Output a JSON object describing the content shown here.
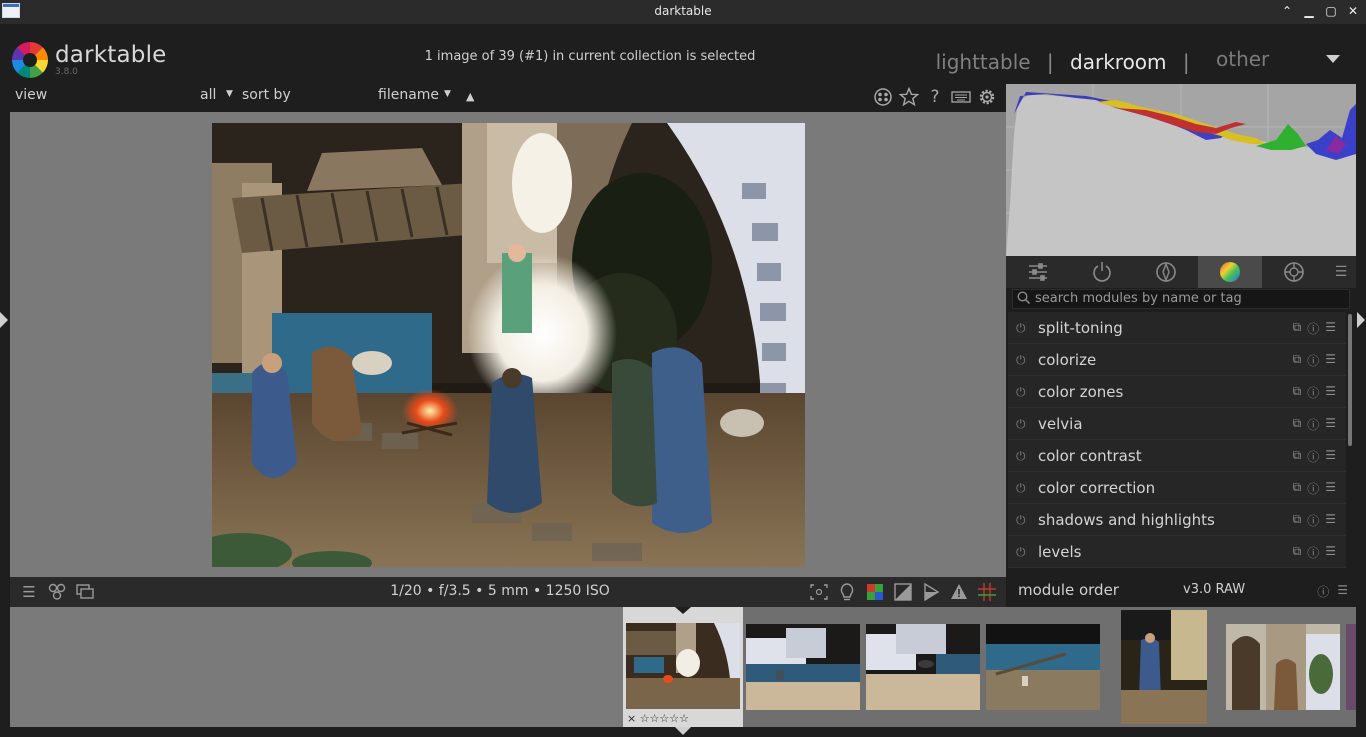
{
  "window": {
    "title": "darktable",
    "buttons": {
      "minimize": "▁",
      "maximize": "▢",
      "close": "✕",
      "restore": "⌃"
    }
  },
  "header": {
    "brand": "darktable",
    "version": "3.8.0",
    "selection_status": "1 image of 39 (#1) in current collection is selected",
    "views": {
      "lighttable": "lighttable",
      "darkroom": "darkroom",
      "other": "other",
      "separator": "|"
    }
  },
  "toolbar": {
    "view_label": "view",
    "rating_filter": "all",
    "sort_label": "sort by",
    "sort_field": "filename",
    "sort_direction_icon": "▲",
    "icons": [
      "color-labels-icon",
      "star-icon",
      "help-icon",
      "keyboard-icon",
      "gear-icon"
    ]
  },
  "exif_info": "1/20 • f/3.5 • 5 mm • 1250 ISO",
  "module_search": {
    "placeholder": "search modules by name or tag"
  },
  "modules": [
    {
      "name": "split-toning"
    },
    {
      "name": "colorize"
    },
    {
      "name": "color zones"
    },
    {
      "name": "velvia"
    },
    {
      "name": "color contrast"
    },
    {
      "name": "color correction"
    },
    {
      "name": "shadows and highlights"
    },
    {
      "name": "levels"
    }
  ],
  "module_order": {
    "label": "module order",
    "value": "v3.0 RAW"
  },
  "filmstrip": {
    "selected_index": 0,
    "selected_stars": "× ☆☆☆☆☆"
  },
  "colors": {
    "background": "#1e1e1e",
    "center_bg": "#7a7a7a",
    "panel_bg": "#262626",
    "histogram_bg": "#a9a9a9",
    "text": "#d4d4d4"
  }
}
